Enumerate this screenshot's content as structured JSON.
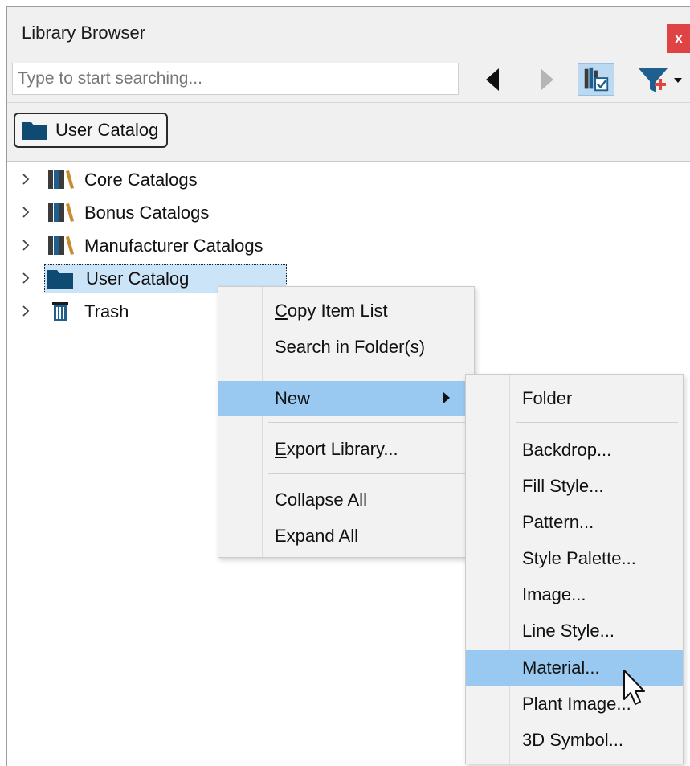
{
  "window": {
    "title": "Library Browser",
    "close_label": "x"
  },
  "toolbar": {
    "search_placeholder": "Type to start searching...",
    "back_icon": "back-arrow-icon",
    "forward_icon": "forward-arrow-icon",
    "view_icon": "library-view-toggle-icon",
    "filter_icon": "filter-add-icon"
  },
  "breadcrumb": {
    "label": "User Catalog"
  },
  "tree": {
    "items": [
      {
        "label": "Core Catalogs",
        "icon": "catalog-books-icon"
      },
      {
        "label": "Bonus Catalogs",
        "icon": "catalog-books-icon"
      },
      {
        "label": "Manufacturer Catalogs",
        "icon": "catalog-books-icon"
      },
      {
        "label": "User Catalog",
        "icon": "folder-icon",
        "selected": true
      },
      {
        "label": "Trash",
        "icon": "trash-icon"
      }
    ]
  },
  "context_menu": {
    "copy_item_list": {
      "label_first": "C",
      "label_rest": "opy Item List"
    },
    "search_in_folders": "Search in Folder(s)",
    "new": "New",
    "export_library": {
      "label_first": "E",
      "label_rest": "xport Library..."
    },
    "collapse_all": "Collapse All",
    "expand_all": "Expand All"
  },
  "new_submenu": {
    "folder": "Folder",
    "backdrop": "Backdrop...",
    "fill_style": "Fill Style...",
    "pattern": "Pattern...",
    "style_palette": "Style Palette...",
    "image": "Image...",
    "line_style": "Line Style...",
    "material": "Material...",
    "plant_image": "Plant Image...",
    "symbol_3d": "3D Symbol..."
  },
  "colors": {
    "chrome": "#f0f0f0",
    "selection": "#cce4f7",
    "menu_highlight": "#99c9f0",
    "folder": "#0f4a72",
    "close": "#e04343"
  }
}
